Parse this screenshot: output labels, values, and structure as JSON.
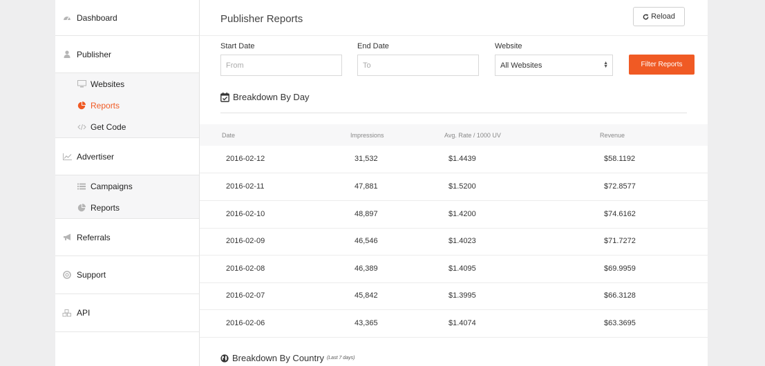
{
  "sidebar": {
    "dashboard": "Dashboard",
    "publisher": {
      "label": "Publisher",
      "items": [
        "Websites",
        "Reports",
        "Get Code"
      ]
    },
    "advertiser": {
      "label": "Advertiser",
      "items": [
        "Campaigns",
        "Reports"
      ]
    },
    "referrals": "Referrals",
    "support": "Support",
    "api": "API",
    "active_color": "#f05a24"
  },
  "header": {
    "title": "Publisher Reports",
    "reload_label": "Reload"
  },
  "filters": {
    "start_label": "Start Date",
    "start_placeholder": "From",
    "end_label": "End Date",
    "end_placeholder": "To",
    "website_label": "Website",
    "website_value": "All Websites",
    "filter_label": "Filter Reports"
  },
  "breakdown_day": {
    "title": "Breakdown By Day",
    "columns": [
      "Date",
      "Impressions",
      "Avg. Rate / 1000 UV",
      "Revenue"
    ],
    "rows": [
      [
        "2016-02-12",
        "31,532",
        "$1.4439",
        "$58.1192"
      ],
      [
        "2016-02-11",
        "47,881",
        "$1.5200",
        "$72.8577"
      ],
      [
        "2016-02-10",
        "48,897",
        "$1.4200",
        "$74.6162"
      ],
      [
        "2016-02-09",
        "46,546",
        "$1.4023",
        "$71.7272"
      ],
      [
        "2016-02-08",
        "46,389",
        "$1.4095",
        "$69.9959"
      ],
      [
        "2016-02-07",
        "45,842",
        "$1.3995",
        "$66.3128"
      ],
      [
        "2016-02-06",
        "43,365",
        "$1.4074",
        "$63.3695"
      ]
    ]
  },
  "breakdown_country": {
    "title": "Breakdown By Country",
    "subtitle": "(Last 7 days)"
  }
}
